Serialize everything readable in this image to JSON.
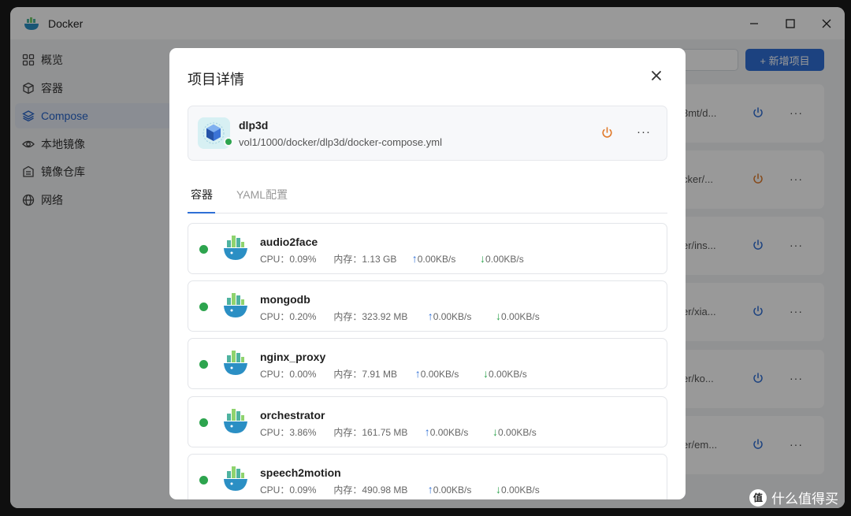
{
  "window": {
    "title": "Docker"
  },
  "sidebar": {
    "items": [
      {
        "label": "概览",
        "icon": "grid-icon",
        "active": false
      },
      {
        "label": "容器",
        "icon": "cube-icon",
        "active": false
      },
      {
        "label": "Compose",
        "icon": "layers-icon",
        "active": true
      },
      {
        "label": "本地镜像",
        "icon": "eye-icon",
        "active": false
      },
      {
        "label": "镜像仓库",
        "icon": "registry-icon",
        "active": false
      },
      {
        "label": "网络",
        "icon": "globe-icon",
        "active": false
      }
    ]
  },
  "toolbar": {
    "add_label": "+ 新增项目"
  },
  "background_cards": [
    {
      "path": "3mt/d...",
      "power_color": "#2f6fd6"
    },
    {
      "path": "cker/...",
      "power_color": "#e07a2a"
    },
    {
      "path": "er/ins...",
      "power_color": "#2f6fd6"
    },
    {
      "path": "er/xia...",
      "power_color": "#2f6fd6"
    },
    {
      "path": "er/ko...",
      "power_color": "#2f6fd6"
    },
    {
      "path": "er/em...",
      "power_color": "#2f6fd6"
    }
  ],
  "modal": {
    "title": "项目详情",
    "project": {
      "name": "dlp3d",
      "path": "vol1/1000/docker/dlp3d/docker-compose.yml",
      "status_color": "#2da44e"
    },
    "tabs": [
      {
        "label": "容器",
        "active": true
      },
      {
        "label": "YAML配置",
        "active": false
      }
    ],
    "containers": [
      {
        "name": "audio2face",
        "cpu": "CPU：0.09%",
        "mem": "内存：1.13 GB",
        "up": "0.00KB/s",
        "down": "0.00KB/s"
      },
      {
        "name": "mongodb",
        "cpu": "CPU：0.20%",
        "mem": "内存：323.92 MB",
        "up": "0.00KB/s",
        "down": "0.00KB/s"
      },
      {
        "name": "nginx_proxy",
        "cpu": "CPU：0.00%",
        "mem": "内存：7.91 MB",
        "up": "0.00KB/s",
        "down": "0.00KB/s"
      },
      {
        "name": "orchestrator",
        "cpu": "CPU：3.86%",
        "mem": "内存：161.75 MB",
        "up": "0.00KB/s",
        "down": "0.00KB/s"
      },
      {
        "name": "speech2motion",
        "cpu": "CPU：0.09%",
        "mem": "内存：490.98 MB",
        "up": "0.00KB/s",
        "down": "0.00KB/s"
      }
    ]
  },
  "watermark": {
    "text": "什么值得买",
    "logo": "值"
  },
  "colors": {
    "accent": "#2f6fd6",
    "running": "#2da44e",
    "warning": "#e07a2a"
  }
}
